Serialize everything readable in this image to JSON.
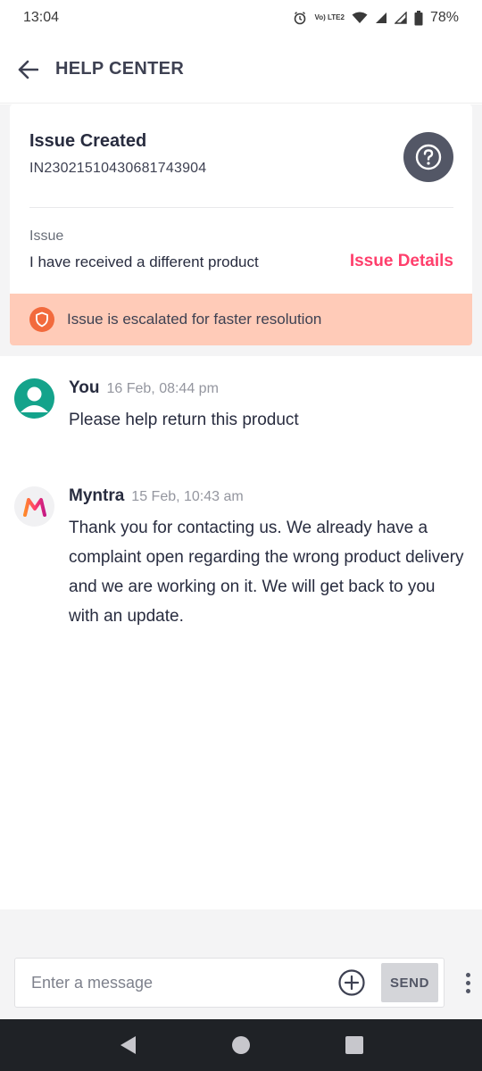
{
  "status_bar": {
    "time": "13:04",
    "network_label": "Vo) LTE2",
    "battery": "78%"
  },
  "header": {
    "title": "HELP CENTER",
    "back_icon": "arrow-left-icon"
  },
  "issue": {
    "title": "Issue Created",
    "id": "IN23021510430681743904",
    "label": "Issue",
    "description": "I have received a different product",
    "details_link": "Issue Details",
    "escalation": "Issue is escalated for faster resolution",
    "help_icon": "question-icon",
    "escalation_icon": "shield-icon",
    "colors": {
      "accent": "#ff3f6c",
      "banner": "#ffcbb8",
      "shield": "#f26a3d"
    }
  },
  "messages": [
    {
      "sender": "You",
      "time": "16 Feb, 08:44 pm",
      "text": "Please help return this product",
      "avatar": "user-avatar-icon"
    },
    {
      "sender": "Myntra",
      "time": "15 Feb, 10:43 am",
      "text": "Thank you for contacting us. We already have a complaint open regarding the wrong product delivery and we are working on it. We will get back to you with an update.",
      "avatar": "myntra-logo-icon"
    }
  ],
  "composer": {
    "placeholder": "Enter a message",
    "send_label": "SEND",
    "attach_icon": "plus-circle-icon",
    "more_icon": "more-vertical-icon"
  },
  "nav_bar": {
    "back_icon": "nav-back-icon",
    "home_icon": "nav-home-icon",
    "recents_icon": "nav-recents-icon"
  }
}
